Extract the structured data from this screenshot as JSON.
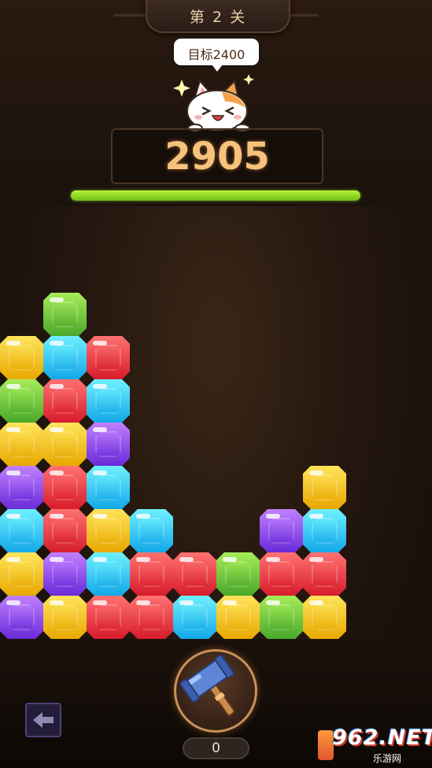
{
  "header": {
    "level_label": "第 2 关",
    "target_label": "目标2400",
    "score": "2905",
    "progress": 1.0
  },
  "colors": {
    "yellow": [
      "#ffe45a",
      "#e8a800"
    ],
    "green": [
      "#a6ec5a",
      "#4aa82a"
    ],
    "blue": [
      "#6ff0ff",
      "#12a8e8"
    ],
    "red": [
      "#ff7272",
      "#d71c2c"
    ],
    "purple": [
      "#c080ff",
      "#6a2ad8"
    ]
  },
  "board": {
    "columns": [
      [
        "purple",
        "yellow",
        "blue",
        "purple",
        "yellow",
        "green",
        "yellow"
      ],
      [
        "yellow",
        "purple",
        "red",
        "red",
        "yellow",
        "red",
        "blue",
        "green"
      ],
      [
        "red",
        "blue",
        "yellow",
        "blue",
        "purple",
        "blue",
        "red"
      ],
      [
        "red",
        "red",
        "blue"
      ],
      [
        "blue",
        "red"
      ],
      [
        "yellow",
        "green"
      ],
      [
        "green",
        "red",
        "purple"
      ],
      [
        "yellow",
        "red",
        "blue",
        "yellow"
      ]
    ]
  },
  "booster": {
    "hammer_count": "0"
  },
  "watermark": {
    "brand": "962.NET",
    "sub": "乐游网"
  }
}
